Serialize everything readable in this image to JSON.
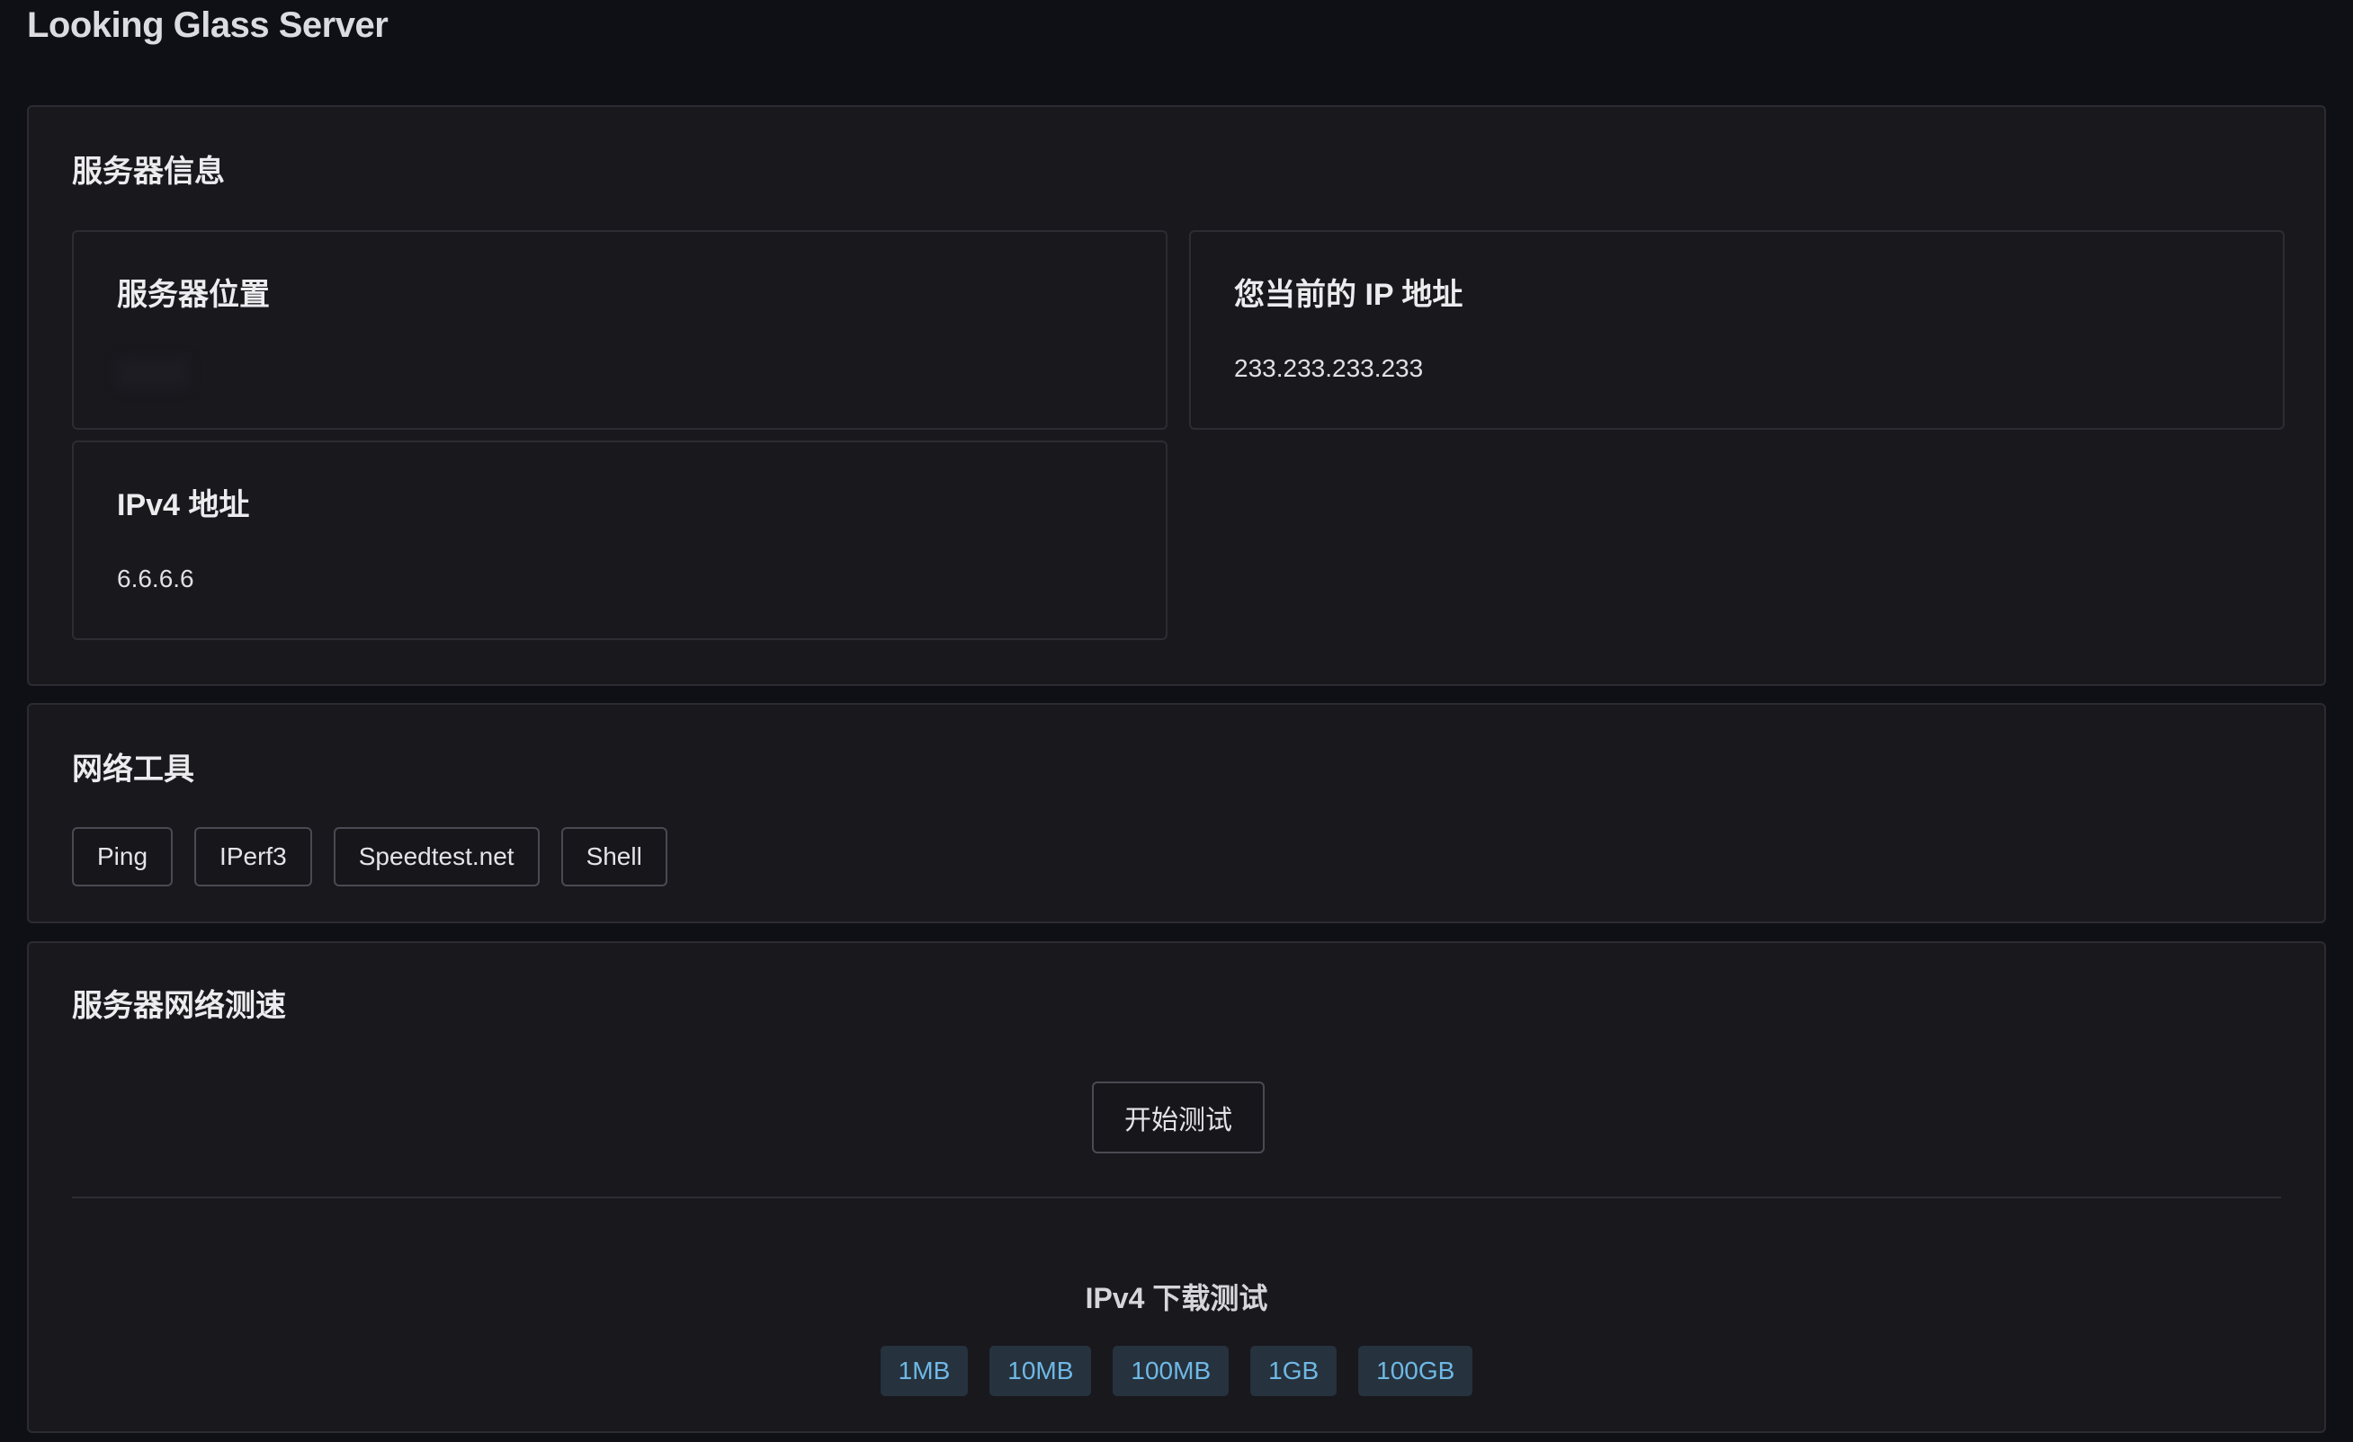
{
  "app": {
    "title": "Looking Glass Server"
  },
  "server_info": {
    "title": "服务器信息",
    "location": {
      "label": "服务器位置",
      "value": ""
    },
    "client_ip": {
      "label": "您当前的 IP 地址",
      "value": "233.233.233.233"
    },
    "ipv4": {
      "label": "IPv4 地址",
      "value": "6.6.6.6"
    }
  },
  "network_tools": {
    "title": "网络工具",
    "buttons": [
      "Ping",
      "IPerf3",
      "Speedtest.net",
      "Shell"
    ]
  },
  "speed_test": {
    "title": "服务器网络测速",
    "start_label": "开始测试",
    "download_title": "IPv4 下载测试",
    "sizes": [
      "1MB",
      "10MB",
      "100MB",
      "1GB",
      "100GB"
    ],
    "accent_color": "#6fb8e6"
  }
}
